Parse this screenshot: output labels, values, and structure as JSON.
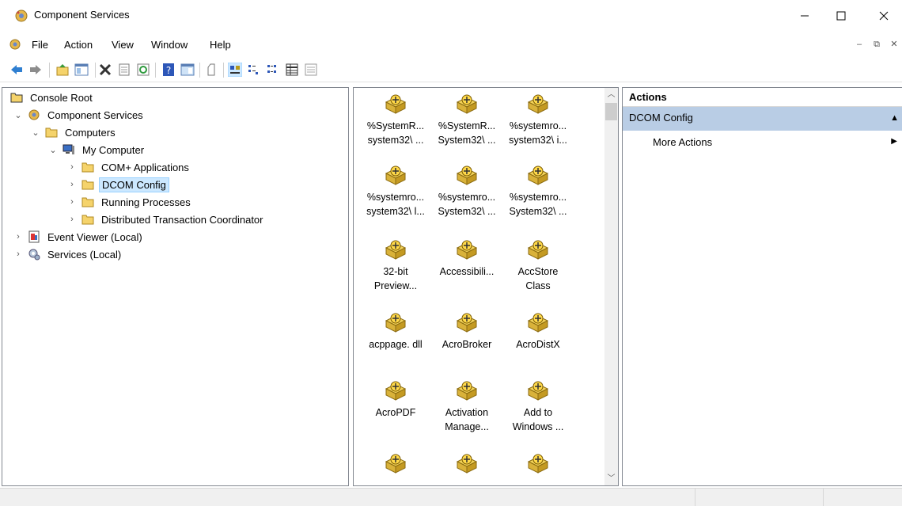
{
  "window": {
    "title": "Component Services"
  },
  "menu": [
    {
      "id": "file",
      "label": "File"
    },
    {
      "id": "action",
      "label": "Action"
    },
    {
      "id": "view",
      "label": "View"
    },
    {
      "id": "window",
      "label": "Window"
    },
    {
      "id": "help",
      "label": "Help"
    }
  ],
  "tree": [
    {
      "label": "Console Root",
      "icon": "folder-icon"
    },
    {
      "label": "Component Services",
      "icon": "component-services-icon"
    },
    {
      "label": "Computers",
      "icon": "folder-icon"
    },
    {
      "label": "My Computer",
      "icon": "computer-icon"
    },
    {
      "label": "COM+ Applications",
      "icon": "folder-icon"
    },
    {
      "label": "DCOM Config",
      "icon": "folder-icon"
    },
    {
      "label": "Running Processes",
      "icon": "folder-icon"
    },
    {
      "label": "Distributed Transaction Coordinator",
      "icon": "folder-icon"
    },
    {
      "label": "Event Viewer (Local)",
      "icon": "event-viewer-icon"
    },
    {
      "label": "Services (Local)",
      "icon": "services-icon"
    }
  ],
  "items": [
    {
      "line1": "%SystemR...",
      "line2": "system32\\ ..."
    },
    {
      "line1": "%SystemR...",
      "line2": "System32\\ ..."
    },
    {
      "line1": "%systemro...",
      "line2": "system32\\ i..."
    },
    {
      "line1": "%systemro...",
      "line2": "system32\\ l..."
    },
    {
      "line1": "%systemro...",
      "line2": "System32\\ ..."
    },
    {
      "line1": "%systemro...",
      "line2": "System32\\ ..."
    },
    {
      "line1": "32-bit",
      "line2": "Preview..."
    },
    {
      "line1": "Accessibili...",
      "line2": ""
    },
    {
      "line1": "AccStore",
      "line2": "Class"
    },
    {
      "line1": "acppage. dll",
      "line2": ""
    },
    {
      "line1": "AcroBroker",
      "line2": ""
    },
    {
      "line1": "AcroDistX",
      "line2": ""
    },
    {
      "line1": "AcroPDF",
      "line2": ""
    },
    {
      "line1": "Activation",
      "line2": "Manage..."
    },
    {
      "line1": "Add to",
      "line2": "Windows ..."
    },
    {
      "line1": "",
      "line2": ""
    },
    {
      "line1": "",
      "line2": ""
    },
    {
      "line1": "",
      "line2": ""
    }
  ],
  "actions": {
    "header": "Actions",
    "group": "DCOM Config",
    "link": "More Actions"
  },
  "colors": {
    "selection": "#cce8ff",
    "actions_group_bg": "#b9cde5",
    "folder": "#f5d36b"
  }
}
